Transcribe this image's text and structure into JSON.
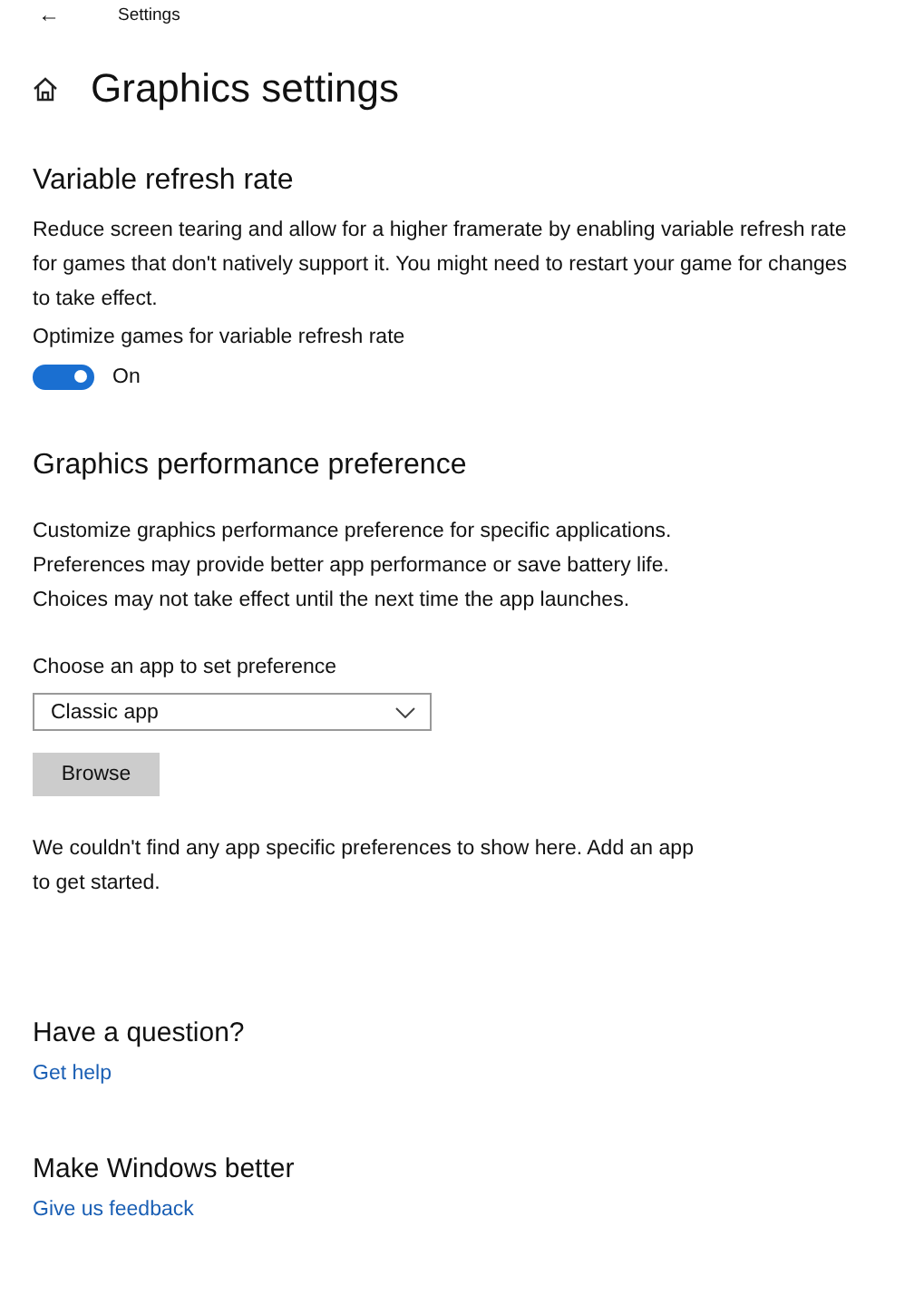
{
  "header": {
    "back": "←",
    "title": "Settings"
  },
  "page_title": "Graphics settings",
  "vrr": {
    "heading": "Variable refresh rate",
    "description": "Reduce screen tearing and allow for a higher framerate by enabling variable refresh rate for games that don't natively support it. You might need to restart your game for changes to take effect.",
    "toggle_label": "Optimize games for variable refresh rate",
    "on": true,
    "state_text": "On"
  },
  "performance": {
    "heading": "Graphics performance preference",
    "description": "Customize graphics performance preference for specific applications. Preferences may provide better app performance or save battery life. Choices may not take effect until the next time the app launches.",
    "dropdown_label": "Choose an app to set preference",
    "dropdown_value": "Classic app",
    "button": "Browse",
    "message": "We couldn't find any app specific preferences to show here. Add an app to get started."
  },
  "help": {
    "heading": "Have a question?",
    "link": "Get help"
  },
  "feedback": {
    "heading": "Make Windows better",
    "link": "Give us feedback"
  }
}
